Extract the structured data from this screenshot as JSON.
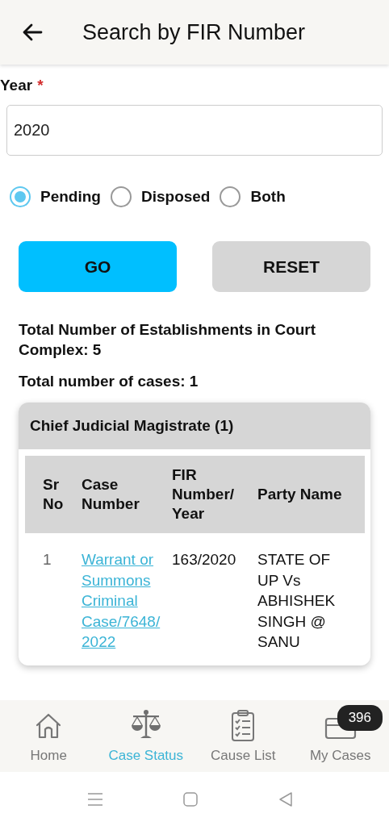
{
  "header": {
    "title": "Search by FIR Number"
  },
  "year_field": {
    "label": "Year",
    "required_mark": "*",
    "value": "2020"
  },
  "status_options": [
    {
      "label": "Pending",
      "selected": true
    },
    {
      "label": "Disposed",
      "selected": false
    },
    {
      "label": "Both",
      "selected": false
    }
  ],
  "buttons": [
    {
      "label": "GO",
      "kind": "primary"
    },
    {
      "label": "RESET",
      "kind": "secondary"
    }
  ],
  "summary": [
    "Total Number of Establishments in Court Complex: 5",
    "Total number of cases: 1"
  ],
  "court_groups": [
    {
      "title": "Chief Judicial Magistrate (1)",
      "table": {
        "columns": [
          "Sr No",
          "Case Number",
          "FIR Number/ Year",
          "Party Name"
        ],
        "rows": [
          {
            "sr_no": "1",
            "case_number": "Warrant or Summons Criminal Case/7648/2022",
            "fir_number_year": "163/2020",
            "party_name": "STATE OF UP Vs ABHISHEK SINGH @ SANU"
          }
        ]
      }
    }
  ],
  "bottom_nav": [
    {
      "label": "Home",
      "selected": false
    },
    {
      "label": "Case Status",
      "selected": true
    },
    {
      "label": "Cause List",
      "selected": false
    },
    {
      "label": "My Cases",
      "selected": false,
      "badge": "396"
    }
  ]
}
